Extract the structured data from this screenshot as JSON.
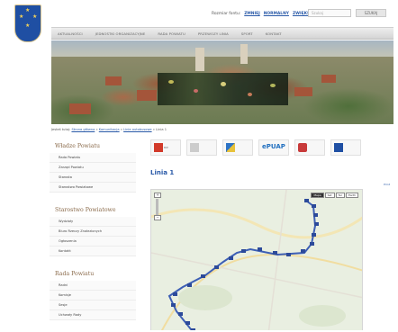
{
  "header": {
    "font_size_label": "Rozmiar fontu:",
    "font_size_options": [
      "ZMNIEJ",
      "NORMALNY",
      "ZWIĘKSZ"
    ],
    "search_placeholder": "Szukaj",
    "search_button": "SZUKAJ"
  },
  "nav": {
    "items": [
      "AKTUALNOŚCI",
      "JEDNOSTKI ORGANIZACYJNE",
      "RADA POWIATU",
      "PRZEWOZY LINIA",
      "SPORT",
      "KONTAKT"
    ]
  },
  "breadcrumb": {
    "prefix": "Jesteś tutaj:",
    "items": [
      "Strona główna",
      "Komunikacja",
      "Linie autobusowe",
      "Linia 1"
    ]
  },
  "sidebar": {
    "sections": [
      {
        "title": "Władze Powiatu",
        "items": [
          "Rada Powiatu",
          "Zarząd Powiatu",
          "Starosta",
          "Starostwo Powiatowe"
        ]
      },
      {
        "title": "Starostwo Powiatowe",
        "items": [
          "Wydziały",
          "Biuro Rzeczy Znalezionych",
          "Ogłoszenia",
          "Kontakt"
        ]
      },
      {
        "title": "Rada Powiatu",
        "items": [
          "Radni",
          "Komisje",
          "Sesje",
          "Uchwały Rady"
        ]
      }
    ]
  },
  "logos": [
    {
      "name": "bip-icon",
      "text": "BIP",
      "color": "#d23a2a"
    },
    {
      "name": "document-icon",
      "text": "ePUAP",
      "color": "#cccccc"
    },
    {
      "name": "flag-icon",
      "text": "",
      "color": "#2e74c6"
    },
    {
      "name": "epuap-icon",
      "text": "ePUAP",
      "color": "#2270c0"
    },
    {
      "name": "eagle-icon",
      "text": "",
      "color": "#c83a3a"
    },
    {
      "name": "eu-flag-icon",
      "text": "",
      "color": "#1f4fa3"
    }
  ],
  "route": {
    "title": "Linia 1",
    "map_types": [
      "Mapa",
      "Sat",
      "Ter",
      "Earth"
    ],
    "mini_links": "Print"
  },
  "colors": {
    "link": "#2a5aa8",
    "route_line": "#3d5fb5",
    "crest": "#1f4fa3"
  }
}
